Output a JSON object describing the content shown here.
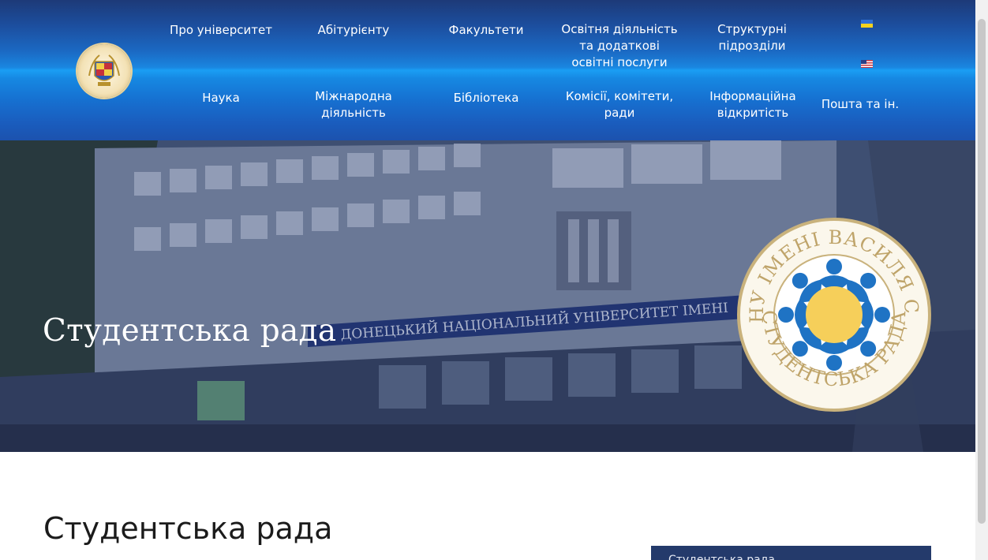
{
  "header": {
    "nav_top": [
      {
        "label": "Про університет"
      },
      {
        "label": "Абітурієнту"
      },
      {
        "label": "Факультети"
      },
      {
        "lines": [
          "Освітня діяльність",
          "та додаткові",
          "освітні послуги"
        ]
      },
      {
        "lines": [
          "Структурні",
          "підрозділи"
        ]
      }
    ],
    "nav_bottom": [
      {
        "lines": [
          "Наука"
        ]
      },
      {
        "lines": [
          "Міжнародна",
          "діяльність"
        ]
      },
      {
        "lines": [
          "Бібліотека"
        ]
      },
      {
        "lines": [
          "Комісії, комітети,",
          "ради"
        ]
      },
      {
        "lines": [
          "Інформаційна",
          "відкритість"
        ]
      },
      {
        "lines": [
          "Пошта та ін."
        ]
      }
    ],
    "flags": [
      "ukraine-flag-icon",
      "usa-flag-icon"
    ]
  },
  "hero": {
    "title": "Студентська рада",
    "building_sign": "ДОНЕЦЬКИЙ НАЦІОНАЛЬНИЙ УНІВЕРСИТЕТ ІМЕНІ",
    "emblem_top_text": "ДОННУ ІМЕНІ ВАСИЛЯ СТУСА",
    "emblem_bottom_text": "СТУДЕНТСЬКА РАДА"
  },
  "content": {
    "page_title": "Студентська рада",
    "sidebar_box_label": "Студентська рада"
  },
  "colors": {
    "header_dark": "#1d3a78",
    "header_bright": "#1a9ef4",
    "sidebar_box": "#243a6b",
    "emblem_blue": "#1f73c4",
    "emblem_sun": "#f6cf5a",
    "emblem_ring": "#c9b27c"
  }
}
